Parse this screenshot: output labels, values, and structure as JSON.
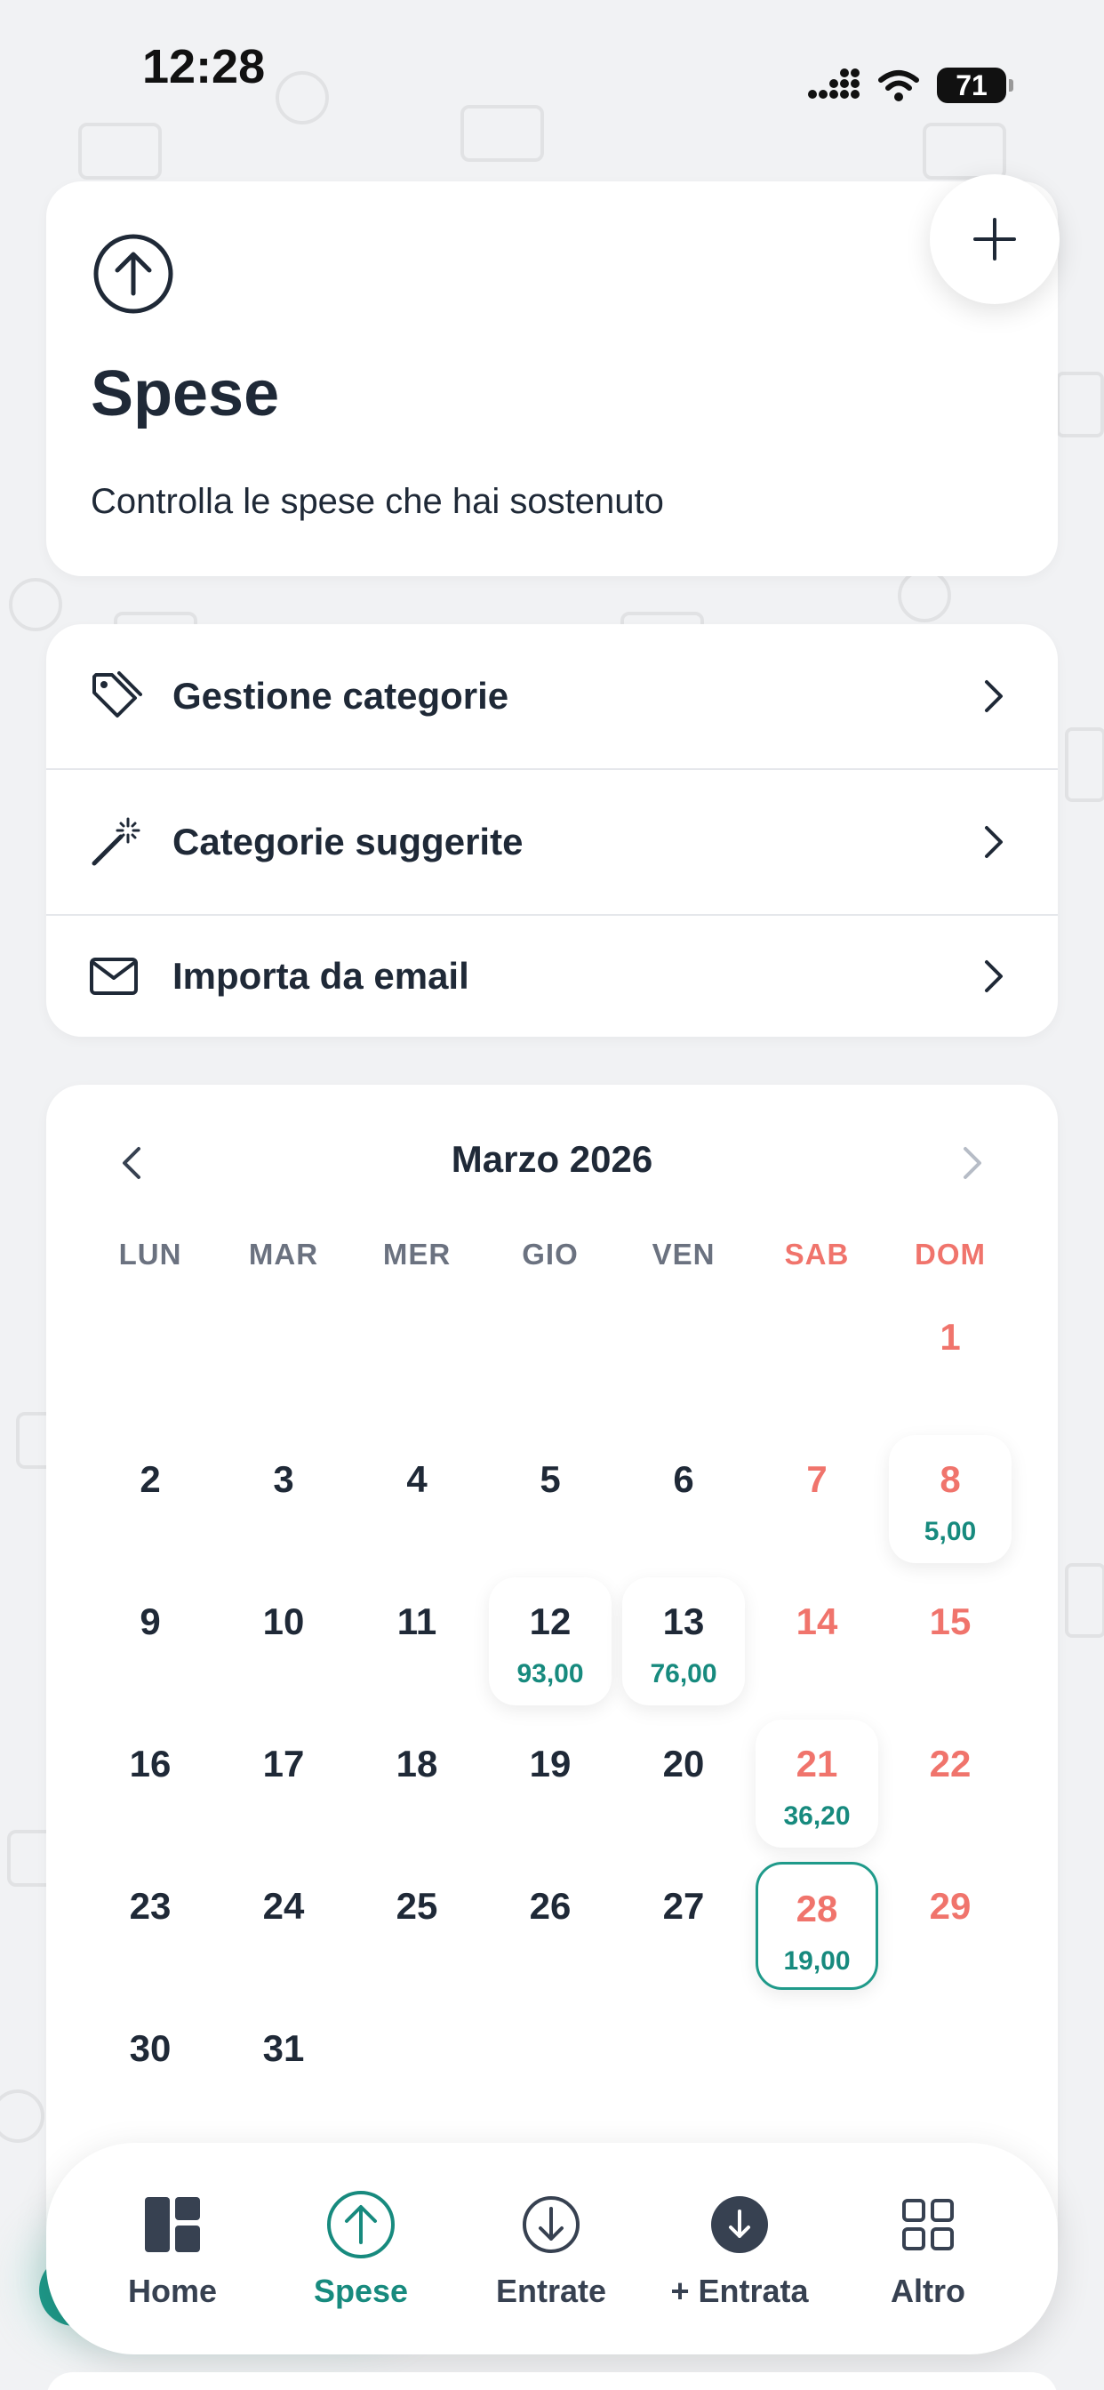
{
  "status_bar": {
    "time": "12:28",
    "battery": "71"
  },
  "header": {
    "title": "Spese",
    "description": "Controlla le spese che hai sostenuto",
    "add_icon": "plus-icon",
    "category_icon": "arrow-up-circle-icon"
  },
  "menu": [
    {
      "label": "Gestione categorie",
      "icon": "tag-icon"
    },
    {
      "label": "Categorie suggerite",
      "icon": "magic-wand-icon"
    },
    {
      "label": "Importa da email",
      "icon": "mail-icon"
    }
  ],
  "calendar": {
    "title": "Marzo 2026",
    "weekdays": [
      "LUN",
      "MAR",
      "MER",
      "GIO",
      "VEN",
      "SAB",
      "DOM"
    ],
    "weekend_color": "#f0746c",
    "amount_color": "#178a7e",
    "selected_day": "28",
    "weeks": [
      [
        null,
        null,
        null,
        null,
        null,
        null,
        {
          "d": "1"
        }
      ],
      [
        {
          "d": "2"
        },
        {
          "d": "3"
        },
        {
          "d": "4"
        },
        {
          "d": "5"
        },
        {
          "d": "6"
        },
        {
          "d": "7"
        },
        {
          "d": "8",
          "a": "5,00"
        }
      ],
      [
        {
          "d": "9"
        },
        {
          "d": "10"
        },
        {
          "d": "11"
        },
        {
          "d": "12",
          "a": "93,00"
        },
        {
          "d": "13",
          "a": "76,00"
        },
        {
          "d": "14"
        },
        {
          "d": "15"
        }
      ],
      [
        {
          "d": "16"
        },
        {
          "d": "17"
        },
        {
          "d": "18"
        },
        {
          "d": "19"
        },
        {
          "d": "20"
        },
        {
          "d": "21",
          "a": "36,20"
        },
        {
          "d": "22"
        }
      ],
      [
        {
          "d": "23"
        },
        {
          "d": "24"
        },
        {
          "d": "25"
        },
        {
          "d": "26"
        },
        {
          "d": "27"
        },
        {
          "d": "28",
          "a": "19,00"
        },
        {
          "d": "29"
        }
      ],
      [
        {
          "d": "30"
        },
        {
          "d": "31"
        },
        null,
        null,
        null,
        null,
        null
      ]
    ]
  },
  "nav": [
    {
      "label": "Home",
      "icon": "dashboard-icon"
    },
    {
      "label": "Spese",
      "icon": "arrow-up-circle-icon",
      "active": true
    },
    {
      "label": "Entrate",
      "icon": "arrow-down-circle-icon"
    },
    {
      "label": "+ Entrata",
      "icon": "arrow-down-filled-icon"
    },
    {
      "label": "Altro",
      "icon": "grid-icon"
    }
  ],
  "accent_color": "#1f9a8a"
}
